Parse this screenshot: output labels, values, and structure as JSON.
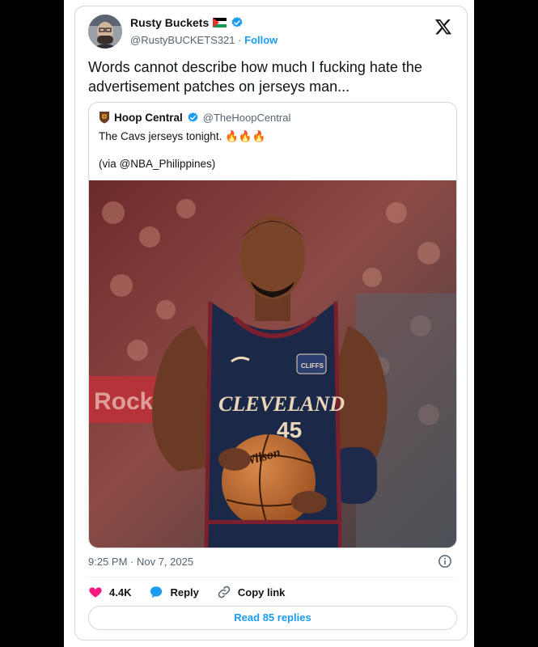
{
  "author": {
    "name": "Rusty Buckets",
    "handle": "@RustyBUCKETS321",
    "separator": "·",
    "follow_label": "Follow",
    "flag_icon": "palestine-flag-icon",
    "verified_color": "#1d9bf0"
  },
  "tweet": {
    "text": "Words cannot describe how much I fucking hate the advertisement patches on jerseys man..."
  },
  "quote": {
    "name": "Hoop Central",
    "handle": "@TheHoopCentral",
    "text": "The Cavs jerseys tonight. 🔥🔥🔥",
    "via": "(via @NBA_Philippines)",
    "photo_jersey": {
      "wordmark": "CLEVELAND",
      "number": "45",
      "patch": "CLIFFS",
      "ball_brand": "Wilson"
    }
  },
  "meta": {
    "timestamp": "9:25 PM · Nov 7, 2025"
  },
  "actions": {
    "likes": "4.4K",
    "reply_label": "Reply",
    "copy_link_label": "Copy link"
  },
  "footer": {
    "read_replies_label": "Read 85 replies"
  },
  "colors": {
    "accent": "#1d9bf0",
    "like": "#f91880",
    "muted": "#536471",
    "border": "#cfd9de"
  }
}
